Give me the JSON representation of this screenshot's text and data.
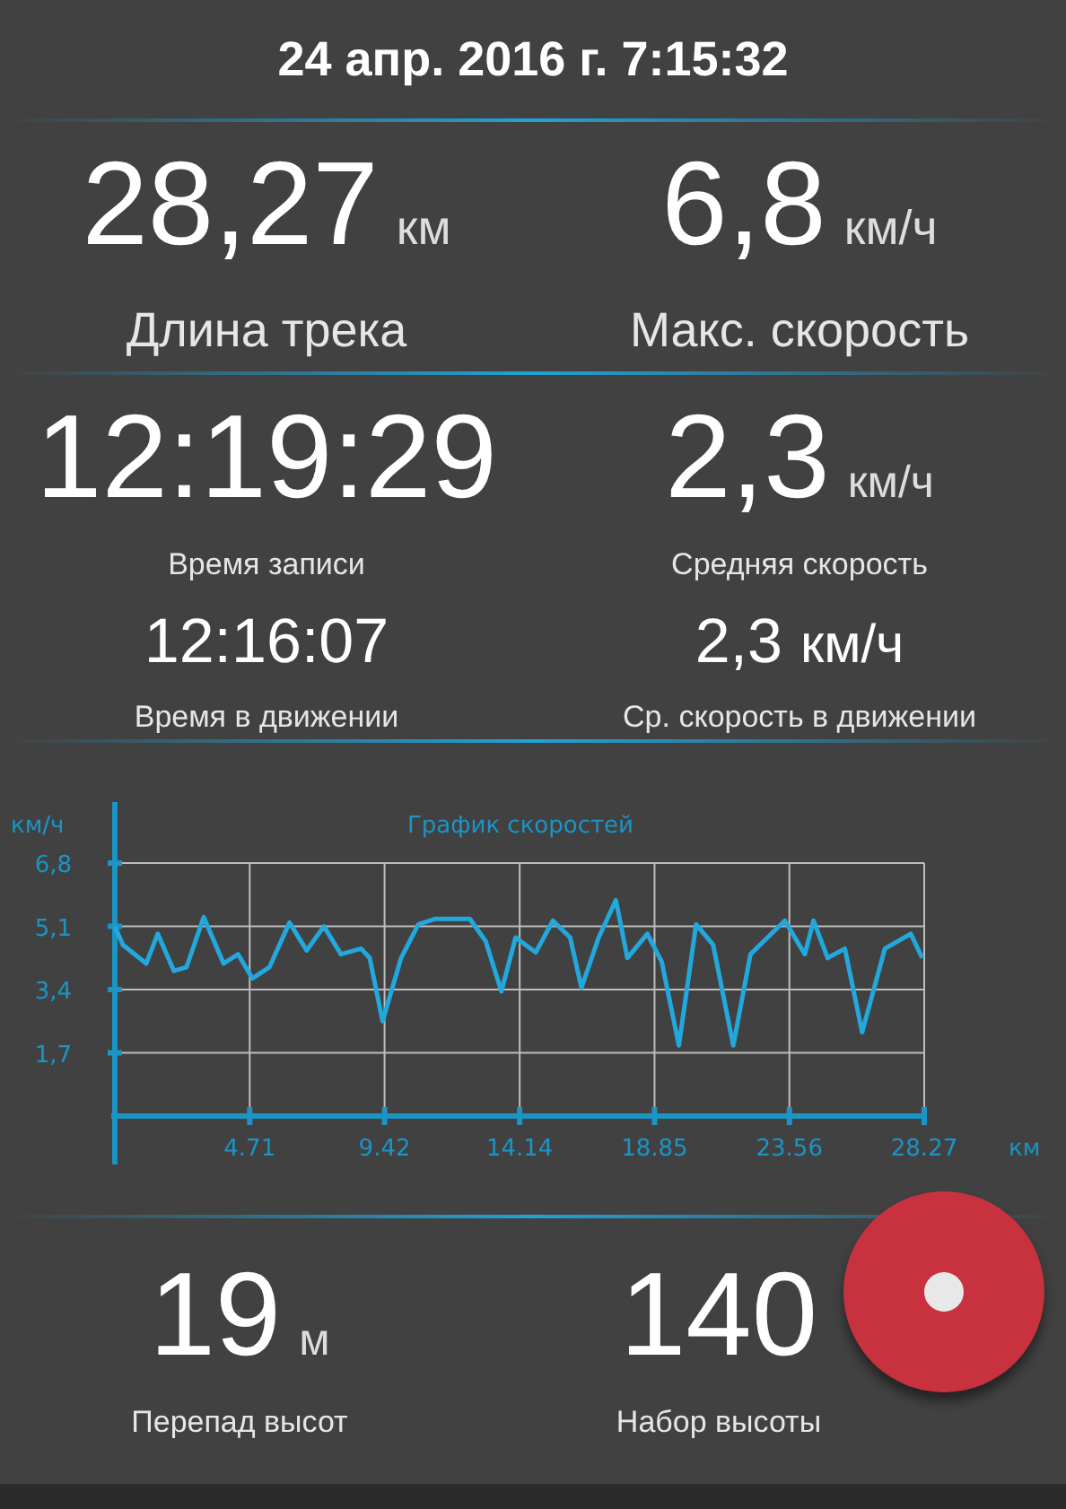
{
  "header": {
    "title": "24 апр. 2016 г. 7:15:32"
  },
  "sections": [
    {
      "rows": [
        {
          "kind": "hero",
          "stats": [
            {
              "value": "28,27",
              "unit": "км",
              "label": "Длина трека"
            },
            {
              "value": "6,8",
              "unit": "км/ч",
              "label": "Макс. скорость"
            }
          ]
        }
      ]
    },
    {
      "rows": [
        {
          "kind": "main",
          "stats": [
            {
              "value": "12:19:29",
              "label": "Время записи"
            },
            {
              "value": "2,3",
              "unit": "км/ч",
              "label": "Средняя скорость"
            }
          ]
        },
        {
          "kind": "sub",
          "stats": [
            {
              "value": "12:16:07",
              "label": "Время в движении"
            },
            {
              "value": "2,3",
              "unit": "км/ч",
              "label": "Ср. скорость в движении"
            }
          ]
        }
      ]
    },
    {
      "chart_data": {
        "type": "line",
        "title": "График скоростей",
        "xlabel": "км",
        "ylabel": "км/ч",
        "xlim": [
          0,
          28.27
        ],
        "ylim": [
          0,
          6.8
        ],
        "grid": true,
        "xticks": [
          4.71,
          9.42,
          14.14,
          18.85,
          23.56,
          28.27
        ],
        "yticks": [
          {
            "value": 1.7,
            "label": "1,7"
          },
          {
            "value": 3.4,
            "label": "3,4"
          },
          {
            "value": 5.1,
            "label": "5,1"
          },
          {
            "value": 6.8,
            "label": "6,8"
          }
        ],
        "x": [
          0,
          0.28,
          1.1,
          1.5,
          2.06,
          2.5,
          3.1,
          3.8,
          4.3,
          4.8,
          5.4,
          6.1,
          6.7,
          7.3,
          7.9,
          8.6,
          8.9,
          9.35,
          10.0,
          10.6,
          11.2,
          12.4,
          12.95,
          13.5,
          14.0,
          14.7,
          15.3,
          15.9,
          16.3,
          16.9,
          17.5,
          17.9,
          18.6,
          19.1,
          19.7,
          20.3,
          20.9,
          21.6,
          22.2,
          22.8,
          23.4,
          24.1,
          24.4,
          24.9,
          25.5,
          26.1,
          26.9,
          27.8,
          28.2
        ],
        "series": [
          {
            "color": "#22a8dc",
            "values": [
              5.1,
              4.6,
              4.1,
              4.9,
              3.9,
              4.0,
              5.35,
              4.1,
              4.35,
              3.7,
              4.0,
              5.2,
              4.45,
              5.1,
              4.35,
              4.5,
              4.25,
              2.55,
              4.25,
              5.15,
              5.3,
              5.3,
              4.7,
              3.35,
              4.8,
              4.4,
              5.25,
              4.8,
              3.45,
              4.8,
              5.8,
              4.25,
              4.9,
              4.15,
              1.9,
              5.15,
              4.6,
              1.9,
              4.35,
              4.8,
              5.25,
              4.35,
              5.25,
              4.25,
              4.5,
              2.25,
              4.5,
              4.9,
              4.25
            ]
          }
        ]
      }
    },
    {
      "rows": [
        {
          "kind": "main",
          "stats": [
            {
              "value": "19",
              "unit": "м",
              "label": "Перепад высот"
            },
            {
              "value": "140",
              "label": "Набор высоты"
            }
          ]
        }
      ]
    }
  ],
  "record_button": {
    "recording": true
  }
}
